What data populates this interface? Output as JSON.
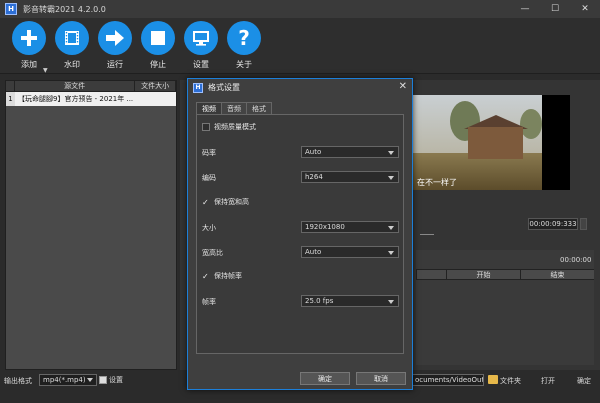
{
  "window": {
    "title": "影音转霸2021 4.2.0.0",
    "minimize": "—",
    "maximize": "☐",
    "close": "✕"
  },
  "toolbar": {
    "add_label": "添加",
    "watermark_label": "水印",
    "run_label": "运行",
    "stop_label": "停止",
    "settings_label": "设置",
    "about_label": "关于",
    "accent_color": "#1b8fe6"
  },
  "file_list": {
    "columns": [
      "源文件",
      "文件大小"
    ],
    "rows": [
      {
        "index": "1",
        "name": "【玩命腿腳9】官方预告 - 2021年 ..."
      }
    ]
  },
  "preview": {
    "subtitle": "在不一样了",
    "time": "00:00:09:333"
  },
  "clips": {
    "time": "00:00:00",
    "columns": [
      "开始",
      "结束"
    ]
  },
  "bottom": {
    "format_label": "输出格式",
    "format_value": "mp4(*.mp4)",
    "settings_label": "设置",
    "output_path": "ocuments/VideoOutput",
    "folder_label": "文件夹",
    "open_label": "打开",
    "start_label": "确定"
  },
  "dialog": {
    "title": "格式设置",
    "close": "✕",
    "tabs": [
      "视频",
      "音频",
      "格式"
    ],
    "quality_mode_label": "视频质量模式",
    "bitrate_label": "码率",
    "bitrate_value": "Auto",
    "encoder_label": "编码",
    "encoder_value": "h264",
    "keep_wh_label": "保持宽和高",
    "size_label": "大小",
    "size_value": "1920x1080",
    "aspect_label": "宽高比",
    "aspect_value": "Auto",
    "keep_fps_label": "保持帧率",
    "fps_label": "帧率",
    "fps_value": "25.0 fps",
    "ok_label": "确定",
    "cancel_label": "取消"
  }
}
